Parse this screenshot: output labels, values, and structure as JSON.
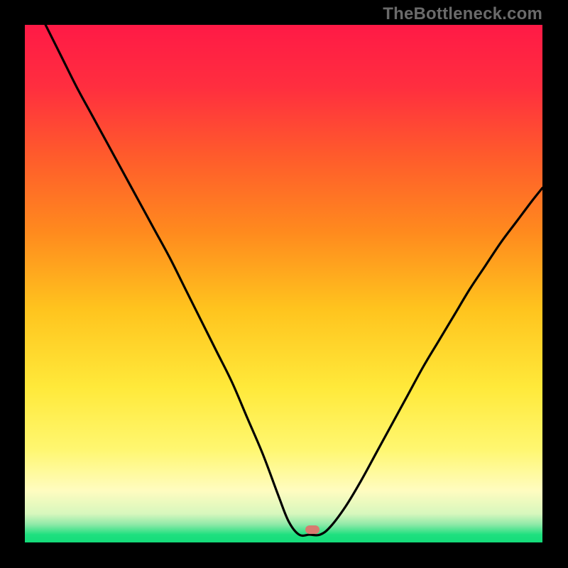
{
  "watermark": "TheBottleneck.com",
  "gradient": {
    "stops": [
      {
        "offset": 0.0,
        "color": "#ff1a46"
      },
      {
        "offset": 0.12,
        "color": "#ff2e3f"
      },
      {
        "offset": 0.25,
        "color": "#ff5a2c"
      },
      {
        "offset": 0.4,
        "color": "#ff8a1e"
      },
      {
        "offset": 0.55,
        "color": "#ffc41e"
      },
      {
        "offset": 0.7,
        "color": "#ffe93a"
      },
      {
        "offset": 0.82,
        "color": "#fff770"
      },
      {
        "offset": 0.9,
        "color": "#fffcc0"
      },
      {
        "offset": 0.945,
        "color": "#d7f7bd"
      },
      {
        "offset": 0.965,
        "color": "#8fe9a8"
      },
      {
        "offset": 0.985,
        "color": "#1ee07f"
      },
      {
        "offset": 1.0,
        "color": "#14dc7a"
      }
    ]
  },
  "marker": {
    "x_frac": 0.555,
    "y_frac": 0.975,
    "color": "#d77a6f"
  },
  "chart_data": {
    "type": "line",
    "title": "",
    "xlabel": "",
    "ylabel": "",
    "xlim": [
      0,
      100
    ],
    "ylim": [
      0,
      100
    ],
    "series": [
      {
        "name": "bottleneck-curve",
        "x": [
          4,
          7,
          10,
          13,
          16,
          19,
          22,
          25,
          28,
          31,
          34,
          37,
          40,
          43,
          46,
          49,
          51,
          53,
          55,
          57,
          59,
          62,
          65,
          68,
          71,
          74,
          77,
          80,
          83,
          86,
          89,
          92,
          95,
          98,
          100
        ],
        "values": [
          100,
          94,
          88,
          82.5,
          77,
          71.5,
          66,
          60.5,
          55,
          49,
          43,
          37,
          31,
          24,
          17,
          9,
          4,
          1.5,
          1.5,
          1.5,
          3,
          7,
          12,
          17.5,
          23,
          28.5,
          34,
          39,
          44,
          49,
          53.5,
          58,
          62,
          66,
          68.5
        ]
      }
    ],
    "marker_point": {
      "x": 55.5,
      "y": 2.5
    }
  }
}
